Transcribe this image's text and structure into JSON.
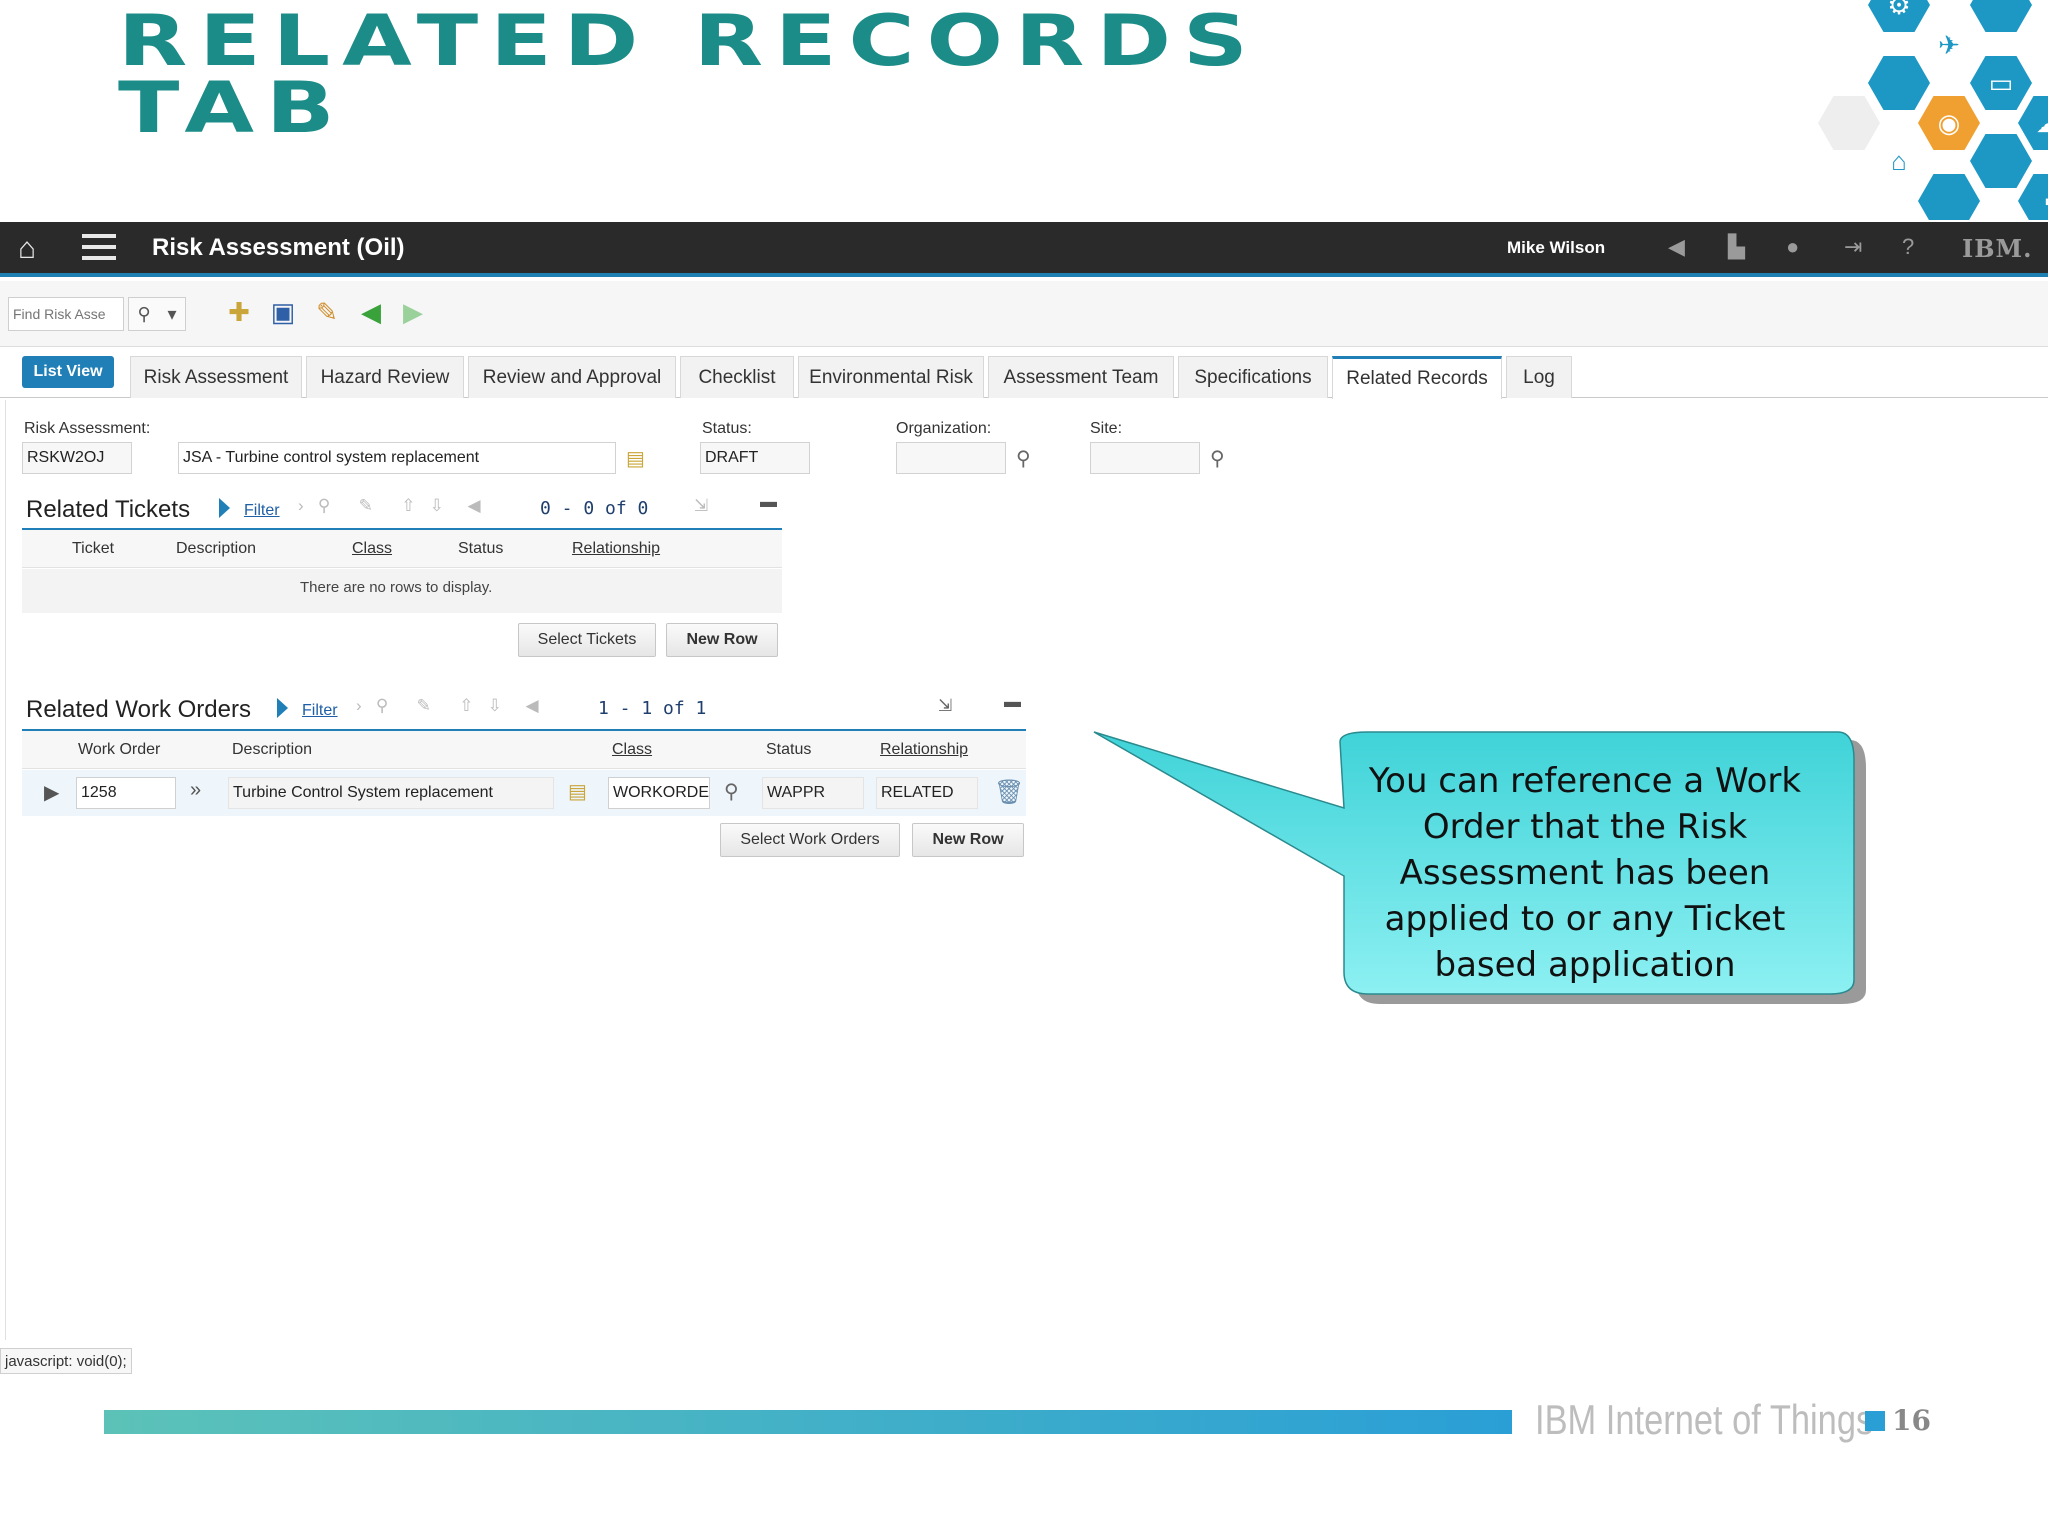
{
  "slide": {
    "title_line1": "Related Records",
    "title_line2": "Tab",
    "footer_brand": "IBM Internet of Things",
    "page_number": "16",
    "accent_color": "#1c8c88"
  },
  "appbar": {
    "title": "Risk Assessment (Oil)",
    "user": "Mike Wilson",
    "logo": "IBM."
  },
  "toolbar": {
    "find_placeholder": "Find Risk Asse"
  },
  "tabs": {
    "list_view": "List View",
    "items": [
      "Risk Assessment",
      "Hazard Review",
      "Review and Approval",
      "Checklist",
      "Environmental Risk",
      "Assessment Team",
      "Specifications",
      "Related Records",
      "Log"
    ],
    "active": "Related Records"
  },
  "header": {
    "risk_label": "Risk Assessment:",
    "risk_id": "RSKW2OJ",
    "risk_desc": "JSA - Turbine control system replacement",
    "status_label": "Status:",
    "status_value": "DRAFT",
    "org_label": "Organization:",
    "site_label": "Site:"
  },
  "tickets": {
    "title": "Related Tickets",
    "filter": "Filter",
    "pager": "0 - 0 of 0",
    "columns": [
      "Ticket",
      "Description",
      "Class",
      "Status",
      "Relationship"
    ],
    "empty": "There are no rows to display.",
    "select_btn": "Select Tickets",
    "new_btn": "New Row"
  },
  "workorders": {
    "title": "Related Work Orders",
    "filter": "Filter",
    "pager": "1 - 1 of 1",
    "columns": [
      "Work Order",
      "Description",
      "Class",
      "Status",
      "Relationship"
    ],
    "row": {
      "work_order": "1258",
      "description": "Turbine Control System replacement",
      "class": "WORKORDE",
      "status": "WAPPR",
      "relationship": "RELATED"
    },
    "select_btn": "Select Work Orders",
    "new_btn": "New Row"
  },
  "callout": {
    "line1": "You can reference a Work",
    "line2": "Order that the Risk",
    "line3": "Assessment has been",
    "line4": "applied to or any Ticket",
    "line5": "based application",
    "fill_color": "#52e0e4"
  },
  "statusbar": {
    "text": "javascript: void(0);"
  }
}
